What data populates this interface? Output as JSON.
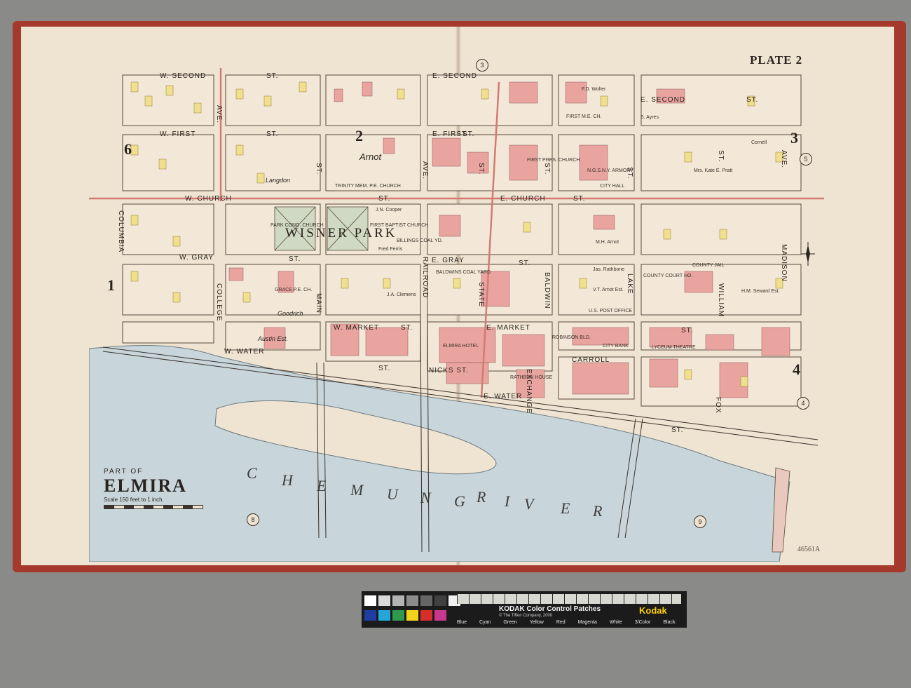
{
  "plate_title": "PLATE 2",
  "catalog_number": "46561A",
  "title_block": {
    "part_of": "PART OF",
    "city": "ELMIRA",
    "scale": "Scale 150 feet to 1 inch."
  },
  "river_label": [
    "C",
    "H",
    "E",
    "M",
    "U",
    "N",
    "G",
    "R",
    "I",
    "V",
    "E",
    "R"
  ],
  "streets": {
    "w_second": "W. SECOND",
    "second_st": "ST.",
    "e_second": "E. SECOND",
    "e_second_right": "E. SECOND",
    "st_right_top": "ST.",
    "w_first": "W. FIRST",
    "first_st": "ST.",
    "e_first": "E. FIRST",
    "e_first_st": "ST.",
    "w_church": "W. CHURCH",
    "church_st": "ST.",
    "e_church": "E. CHURCH",
    "church_st_right": "ST.",
    "w_gray": "W. GRAY",
    "gray_st": "ST.",
    "e_gray": "E. GRAY",
    "e_gray_st": "ST.",
    "w_market": "W. MARKET",
    "market_st": "ST.",
    "e_market": "E. MARKET",
    "market_st_right": "ST.",
    "w_water": "W. WATER",
    "water_st": "ST.",
    "e_water": "E. WATER",
    "water_st_right": "ST.",
    "carroll": "CARROLL",
    "nicks_st": "NICKS ST.",
    "columbia": "COLUMBIA",
    "college": "COLLEGE",
    "college_ave": "AVE.",
    "main": "MAIN",
    "main_st": "ST.",
    "railroad": "RAILROAD",
    "railroad_ave": "AVE.",
    "state": "STATE",
    "state_st": "ST.",
    "baldwin": "BALDWIN",
    "baldwin_st": "ST.",
    "lake": "LAKE",
    "lake_st": "ST.",
    "william": "WILLIAM",
    "william_st": "ST.",
    "madison": "MADISON",
    "madison_ave": "AVE.",
    "exchange": "EXCHANGE",
    "fox": "FOX"
  },
  "landmarks": {
    "wisner_park": "WISNER PARK",
    "arnot": "Arnot",
    "langdon": "Langdon",
    "trinity": "TRINITY MEM. P.E. CHURCH",
    "first_baptist": "FIRST BAPTIST CHURCH",
    "park_church": "PARK CONG. CHURCH",
    "city_hall": "CITY HALL",
    "armory": "N.G.S.N.Y. ARMORY",
    "first_me": "FIRST M.E. CH.",
    "first_pres": "FIRST PRES. CHURCH",
    "county_jail": "COUNTY JAIL",
    "county_court": "COUNTY COURT HO.",
    "post_office": "U.S. POST OFFICE",
    "lyceum": "LYCEUM THEATRE",
    "robinson": "ROBINSON BLD.",
    "city_bank": "CITY BANK",
    "rathbun": "RATHBUN HOUSE",
    "elmira_hotel": "ELMIRA HOTEL",
    "baldwins_coal": "BALDWINS COAL YARD",
    "billings": "BILLINGS COAL YD.",
    "grace_church": "GRACE P.E. CH.",
    "austin_est": "Austin Est.",
    "goodrich": "Goodrich",
    "ja_clemens": "J.A. Clemens",
    "fred_ferris": "Fred Ferris",
    "jn_cooper": "J.N. Cooper",
    "hm_seward": "H.M. Seward Est.",
    "vt_arnot": "V.T. Arnot Est.",
    "jas_rathbone": "Jas. Rathbone",
    "mh_arnot": "M.H. Arnot",
    "mrs_kate": "Mrs. Kate E. Pratt",
    "fd_wolter": "F.D. Wolter",
    "sayres": "S. Ayres",
    "cornell": "Cornell"
  },
  "wards": [
    "6",
    "2",
    "3",
    "1",
    "4"
  ],
  "sheet_numbers": [
    "3",
    "5",
    "4",
    "8",
    "9"
  ],
  "color_control": {
    "title": "KODAK Color Control Patches",
    "brand": "Kodak",
    "copyright": "© The Tiffen Company, 2000",
    "labels": [
      "Blue",
      "Cyan",
      "Green",
      "Yellow",
      "Red",
      "Magenta",
      "White",
      "3/Color",
      "Black"
    ],
    "gray_patches": [
      "#ffffff",
      "#d9d9d9",
      "#b3b3b3",
      "#8c8c8c",
      "#666666",
      "#404040",
      "#f0f0f0"
    ],
    "color_patches": [
      "#1f3da3",
      "#25a6d9",
      "#2f9a4c",
      "#f2d21a",
      "#d62e2b",
      "#c8378c",
      "#f5f5f5",
      "#3a3a3a",
      "#111111"
    ]
  },
  "colors": {
    "paper": "#efe3d2",
    "brick_pink": "#e9a4a0",
    "frame_yellow": "#f0df8c",
    "stone_green": "#cfd9c3",
    "river": "#c8d5da",
    "binding_red": "#a53a2c"
  }
}
